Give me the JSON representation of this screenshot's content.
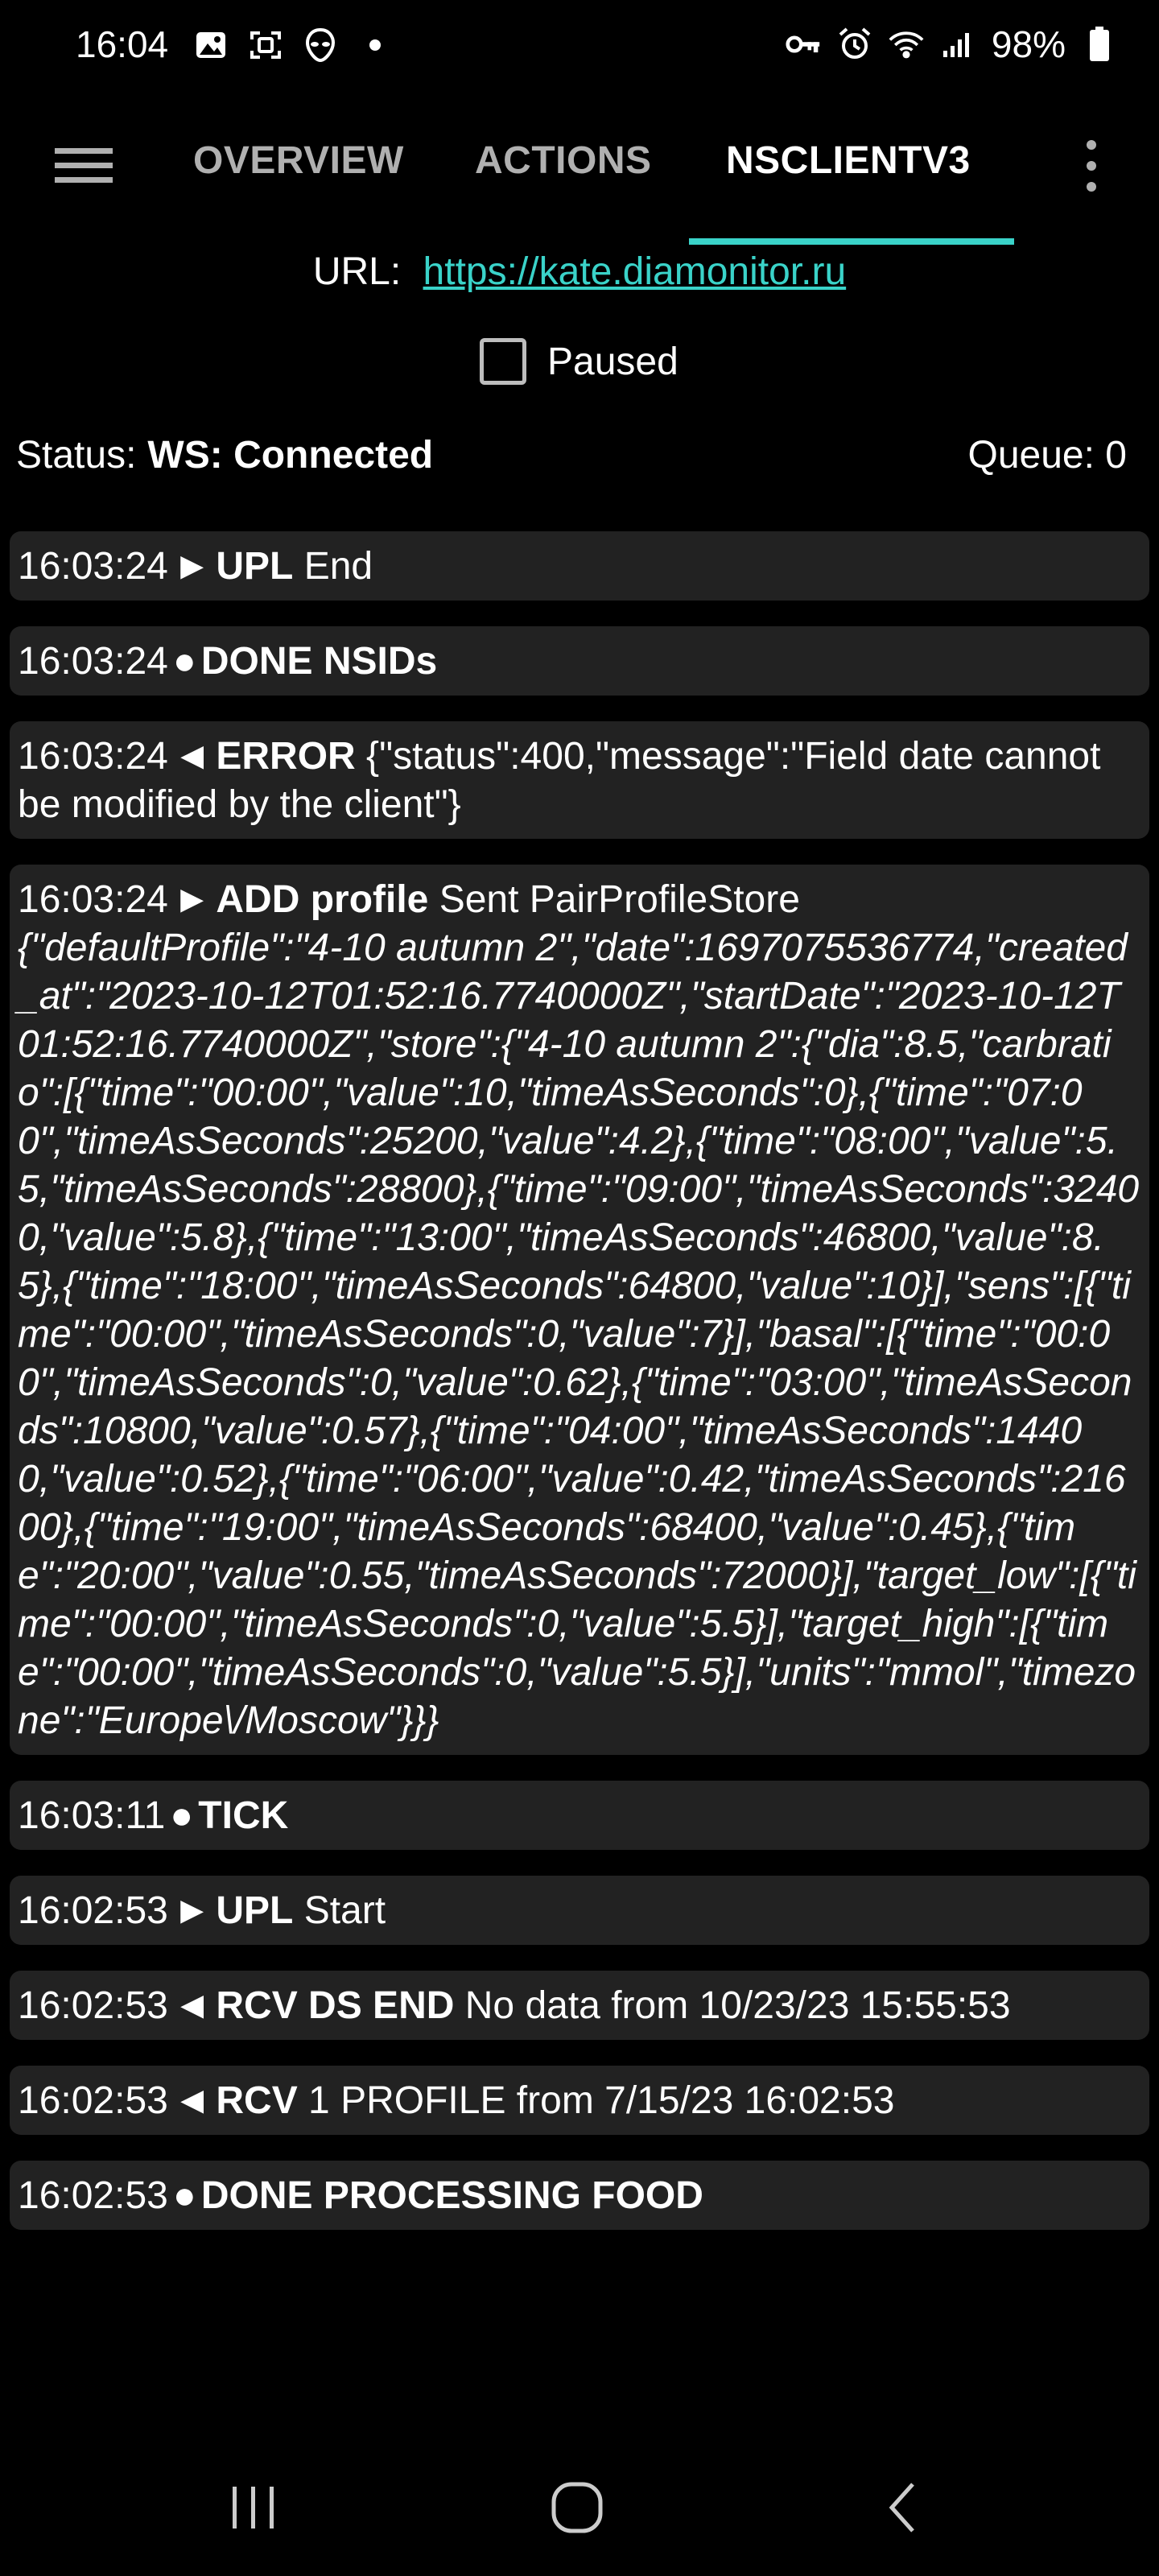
{
  "status_bar": {
    "time": "16:04",
    "battery": "98%"
  },
  "tabs": [
    {
      "label": "OVERVIEW"
    },
    {
      "label": "ACTIONS"
    },
    {
      "label": "NSCLIENTV3"
    }
  ],
  "url": {
    "label": "URL:",
    "link": "https://kate.diamonitor.ru"
  },
  "paused": {
    "label": "Paused",
    "checked": false
  },
  "connection": {
    "status_label": "Status:",
    "status_value": "WS: Connected",
    "queue_label": "Queue:",
    "queue_value": "0"
  },
  "log": [
    {
      "time": "16:03:24",
      "symbol": "►",
      "action": "UPL",
      "text": "End",
      "json": ""
    },
    {
      "time": "16:03:24",
      "symbol": "●",
      "action": "DONE NSIDs",
      "text": "",
      "json": ""
    },
    {
      "time": "16:03:24",
      "symbol": "◄",
      "action": "ERROR",
      "text": "{\"status\":400,\"message\":\"Field date cannot be modified by the client\"}",
      "json": ""
    },
    {
      "time": "16:03:24",
      "symbol": "►",
      "action": "ADD profile",
      "text": "Sent PairProfileStore",
      "json": "{\"defaultProfile\":\"4-10 autumn 2\",\"date\":1697075536774,\"created_at\":\"2023-10-12T01:52:16.7740000Z\",\"startDate\":\"2023-10-12T01:52:16.7740000Z\",\"store\":{\"4-10 autumn 2\":{\"dia\":8.5,\"carbratio\":[{\"time\":\"00:00\",\"value\":10,\"timeAsSeconds\":0},{\"time\":\"07:00\",\"timeAsSeconds\":25200,\"value\":4.2},{\"time\":\"08:00\",\"value\":5.5,\"timeAsSeconds\":28800},{\"time\":\"09:00\",\"timeAsSeconds\":32400,\"value\":5.8},{\"time\":\"13:00\",\"timeAsSeconds\":46800,\"value\":8.5},{\"time\":\"18:00\",\"timeAsSeconds\":64800,\"value\":10}],\"sens\":[{\"time\":\"00:00\",\"timeAsSeconds\":0,\"value\":7}],\"basal\":[{\"time\":\"00:00\",\"timeAsSeconds\":0,\"value\":0.62},{\"time\":\"03:00\",\"timeAsSeconds\":10800,\"value\":0.57},{\"time\":\"04:00\",\"timeAsSeconds\":14400,\"value\":0.52},{\"time\":\"06:00\",\"value\":0.42,\"timeAsSeconds\":21600},{\"time\":\"19:00\",\"timeAsSeconds\":68400,\"value\":0.45},{\"time\":\"20:00\",\"value\":0.55,\"timeAsSeconds\":72000}],\"target_low\":[{\"time\":\"00:00\",\"timeAsSeconds\":0,\"value\":5.5}],\"target_high\":[{\"time\":\"00:00\",\"timeAsSeconds\":0,\"value\":5.5}],\"units\":\"mmol\",\"timezone\":\"Europe\\/Moscow\"}}}"
    },
    {
      "time": "16:03:11",
      "symbol": "●",
      "action": "TICK",
      "text": "",
      "json": ""
    },
    {
      "time": "16:02:53",
      "symbol": "►",
      "action": "UPL",
      "text": "Start",
      "json": ""
    },
    {
      "time": "16:02:53",
      "symbol": "◄",
      "action": "RCV DS END",
      "text": "No data from 10/23/23 15:55:53",
      "json": ""
    },
    {
      "time": "16:02:53",
      "symbol": "◄",
      "action": "RCV",
      "text": "1 PROFILE from 7/15/23 16:02:53",
      "json": ""
    },
    {
      "time": "16:02:53",
      "symbol": "●",
      "action": "DONE PROCESSING FOOD",
      "text": "",
      "json": ""
    }
  ],
  "colors": {
    "accent": "#3ad3c9",
    "background": "#000000",
    "card": "#222222"
  }
}
